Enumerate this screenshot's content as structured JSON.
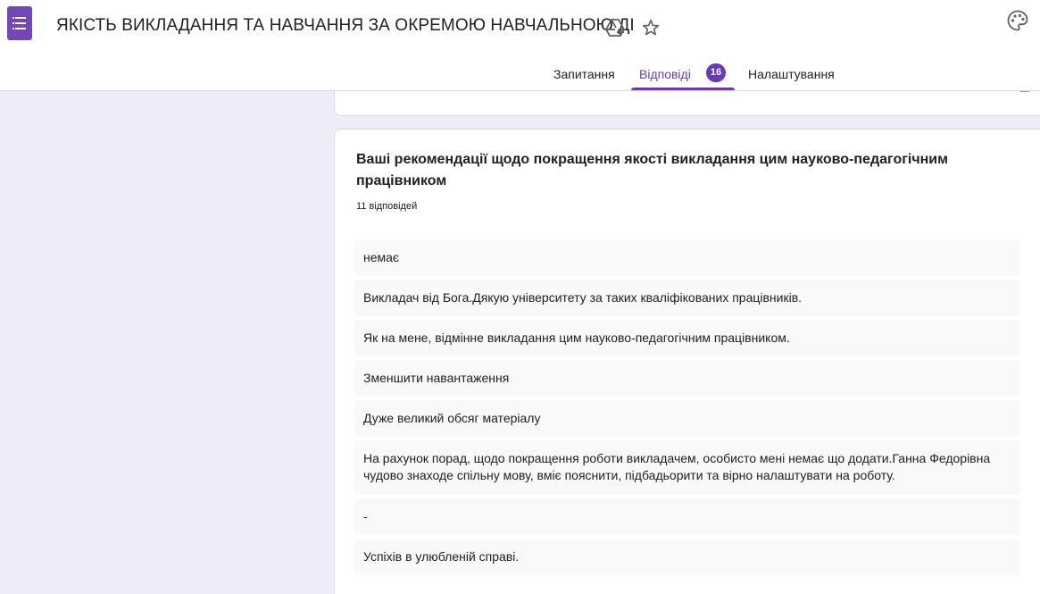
{
  "header": {
    "title": "ЯКІСТЬ ВИКЛАДАННЯ ТА НАВЧАННЯ ЗА ОКРЕМОЮ НАВЧАЛЬНОЮ ДІ",
    "icons": {
      "logo": "forms-list-icon",
      "drive": "move-to-drive-icon",
      "star": "star-outline-icon",
      "palette": "palette-icon"
    },
    "accent_color": "#673ab7"
  },
  "tabs": {
    "questions": "Запитання",
    "responses": "Відповіді",
    "responses_badge": "16",
    "settings": "Налаштування",
    "active": "responses"
  },
  "question": {
    "title": "Ваші рекомендації щодо покращення якості викладання цим науково-педагогічним працівником",
    "count": "11 відповідей",
    "responses": [
      "немає",
      "Викладач від Бога.Дякую університету за таких кваліфікованих працівників.",
      "Як на мене, відмінне викладання цим науково-педагогічним працівником.",
      "Зменшити навантаження",
      "Дуже великий обсяг матеріалу",
      "На рахунок порад, щодо покращення роботи викладачем, особисто мені немає що додати.Ганна Федорівна чудово знаходе спільну мову, вміє пояснити, підбадьорити та вірно налаштувати на роботу.",
      "-",
      "Успіхів в улюбленій справі."
    ]
  }
}
